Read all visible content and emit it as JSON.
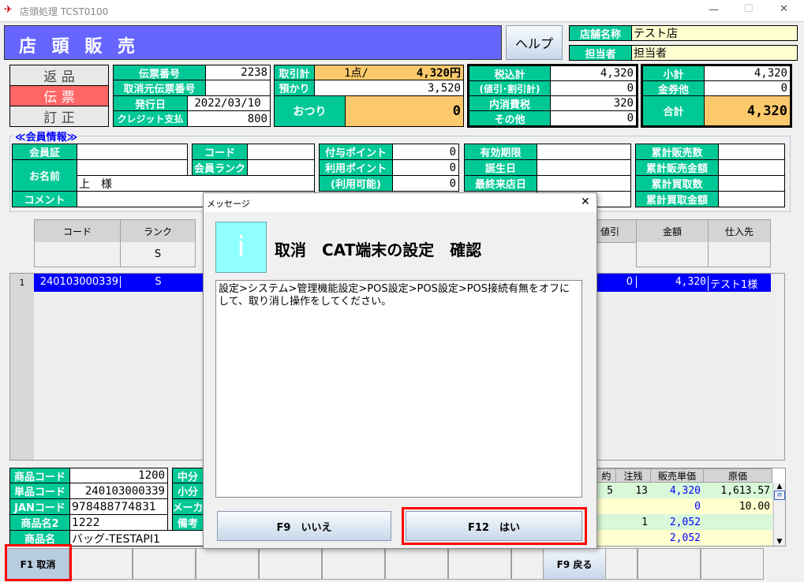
{
  "window": {
    "title": "店頭処理 TCST0100",
    "minimize": "—",
    "maximize": "☐",
    "close": "✕"
  },
  "header": {
    "title": "店 頭 販 売",
    "help": "ヘルプ",
    "store_label": "店舗名称",
    "store_value": "テスト店",
    "staff_label": "担当者",
    "staff_value": "担当者"
  },
  "modes": [
    "返 品",
    "伝 票",
    "訂 正"
  ],
  "slip": {
    "no_label": "伝票番号",
    "no": "2238",
    "orig_label": "取消元伝票番号",
    "orig": "",
    "date_label": "発行日",
    "date": "2022/03/10",
    "credit_label": "クレジット支払",
    "credit": "800"
  },
  "trade": {
    "total_label": "取引計",
    "count": "1点/",
    "amount": "4,320円",
    "deposit_label": "預かり",
    "deposit": "3,520",
    "change_label": "おつり",
    "change": "0"
  },
  "tax": {
    "incl_label": "税込計",
    "incl": "4,320",
    "disc_label": "(値引･割引計)",
    "disc": "0",
    "inner_label": "内消費税",
    "inner": "320",
    "other_label": "その他",
    "other": "0"
  },
  "sum": {
    "sub_label": "小計",
    "sub": "4,320",
    "voucher_label": "金券他",
    "voucher": "0",
    "total_label": "合計",
    "total": "4,320"
  },
  "member": {
    "legend": "≪会員情報≫",
    "card": "会員証",
    "name": "お名前",
    "name_value": "上　様",
    "comment": "コメント",
    "code": "コード",
    "rank": "会員ランク",
    "grant_pt": "付与ポイント",
    "grant_pt_v": "0",
    "use_pt": "利用ポイント",
    "use_pt_v": "0",
    "avail": "(利用可能)",
    "avail_v": "0",
    "expiry": "有効期限",
    "birthday": "誕生日",
    "last_visit": "最終来店日",
    "cum_sales_n": "累計販売数",
    "cum_sales_amt": "累計販売金額",
    "cum_buy_n": "累計買取数",
    "cum_buy_amt": "累計買取金額"
  },
  "grid": {
    "headers": {
      "code": "コード",
      "rank": "ランク",
      "disc": "値引",
      "amount": "金額",
      "supplier": "仕入先"
    },
    "filter_rank": "S",
    "row": {
      "no": "1",
      "code": "240103000339",
      "rank": "S",
      "disc": "0",
      "amount": "4,320",
      "supplier": "テスト1様"
    }
  },
  "product": {
    "code_label": "商品コード",
    "code": "1200",
    "item_label": "単品コード",
    "item": "240103000339",
    "jan_label": "JANコード",
    "jan": "978488774831",
    "name2_label": "商品名2",
    "name2": "1222",
    "name_label": "商品名",
    "name": "バッグ-TESTAPI1",
    "mid_label": "中分",
    "small_label": "小分",
    "maker_label": "メーカ",
    "note_label": "備考"
  },
  "stock": {
    "headers": [
      "約",
      "注残",
      "販売単価",
      "原価"
    ],
    "rows": [
      [
        "5",
        "13",
        "4,320",
        "1,613.57"
      ],
      [
        "",
        "",
        "0",
        "10.00"
      ],
      [
        "",
        "1",
        "2,052",
        ""
      ],
      [
        "",
        "",
        "2,052",
        ""
      ]
    ]
  },
  "fkeys": {
    "f1": "F1 取消",
    "f9": "F9 戻る"
  },
  "dialog": {
    "title": "メッセージ",
    "heading": "取消　CAT端末の設定　確認",
    "message": "設定>システム>管理機能設定>POS設定>POS設定>POS接続有無をオフにして、取り消し操作をしてください。",
    "no": "F9　いいえ",
    "yes": "F12　はい",
    "close": "✕",
    "icon": "i"
  }
}
